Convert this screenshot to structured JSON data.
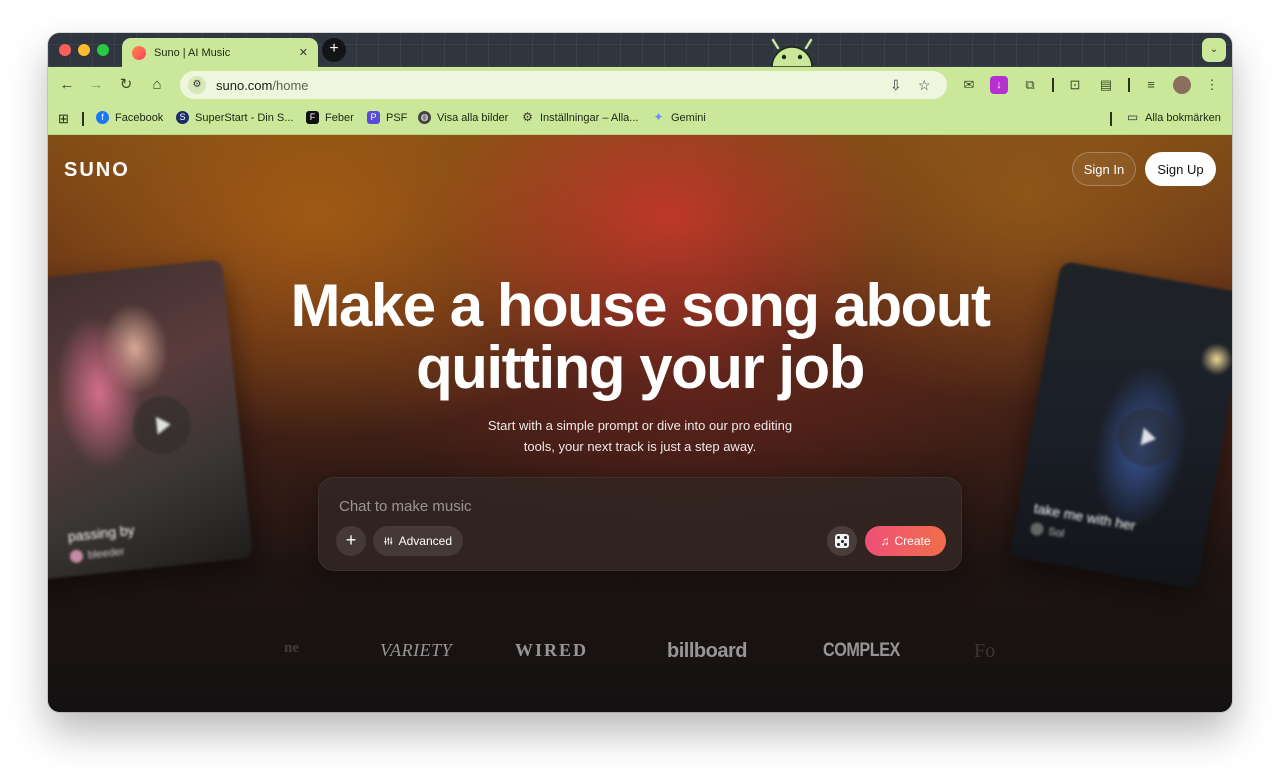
{
  "browser": {
    "tab": {
      "title": "Suno | AI Music",
      "close": "✕"
    },
    "new_tab": "+",
    "tab_search": "⌄",
    "nav": {
      "back": "←",
      "forward": "→",
      "reload": "↻",
      "home": "⌂"
    },
    "address": {
      "host": "suno.com",
      "path": "/home"
    },
    "bookmarks": [
      {
        "label": "Facebook",
        "icon": "facebook-icon",
        "color": "#1877f2"
      },
      {
        "label": "SuperStart - Din S...",
        "icon": "superstart-icon",
        "color": "#1d2b6b"
      },
      {
        "label": "Feber",
        "icon": "feber-icon",
        "color": "#111111"
      },
      {
        "label": "PSF",
        "icon": "psf-icon",
        "color": "#5b4bdb"
      },
      {
        "label": "Visa alla bilder",
        "icon": "globe-icon",
        "color": "#333333"
      },
      {
        "label": "Inställningar – Alla...",
        "icon": "gear-icon",
        "color": "#333333"
      },
      {
        "label": "Gemini",
        "icon": "gemini-icon",
        "color": "#6d8cf5"
      }
    ],
    "all_bookmarks": "Alla bokmärken"
  },
  "site": {
    "logo": "SUNO",
    "sign_in": "Sign In",
    "sign_up": "Sign Up",
    "headline_line1": "Make a house song about",
    "headline_line2": "quitting your job",
    "subtitle_line1": "Start with a simple prompt or dive into our pro editing",
    "subtitle_line2": "tools, your next track is just a step away.",
    "chat_placeholder": "Chat to make music",
    "advanced": "Advanced",
    "create": "Create",
    "cards": [
      {
        "title": "passing by",
        "artist": "bleeder"
      },
      {
        "title": "take me with her",
        "artist": "Sol"
      }
    ],
    "press": {
      "fade_left": "ne",
      "variety": "VARIETY",
      "wired": "WIRED",
      "billboard": "billboard",
      "complex": "COMPLEX",
      "fade_right": "Fo"
    }
  },
  "colors": {
    "chrome_theme": "#cbe89a",
    "create_gradient_start": "#ef4f78",
    "create_gradient_end": "#f06f4a"
  }
}
